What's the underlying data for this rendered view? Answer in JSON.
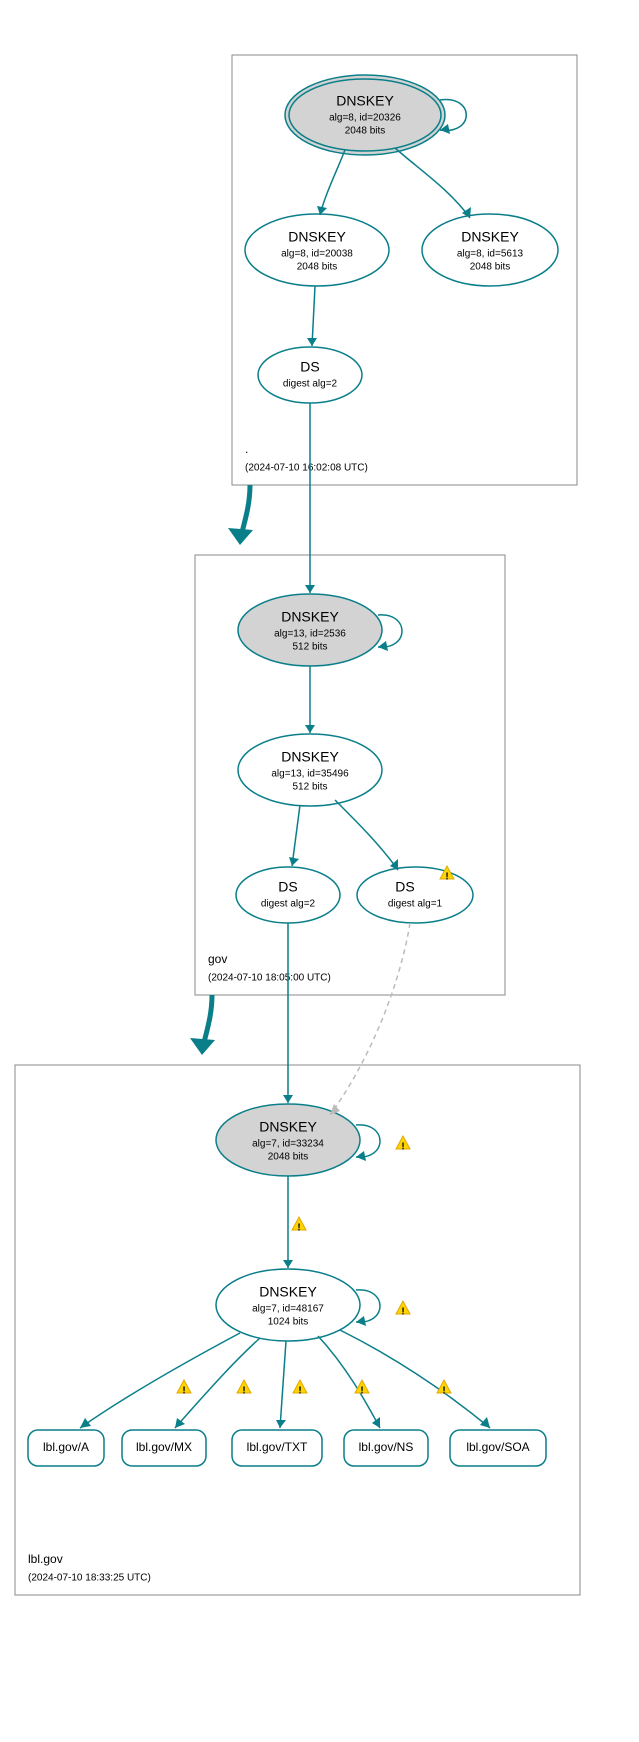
{
  "zones": {
    "root": {
      "name": ".",
      "timestamp": "(2024-07-10 16:02:08 UTC)"
    },
    "gov": {
      "name": "gov",
      "timestamp": "(2024-07-10 18:05:00 UTC)"
    },
    "lbl": {
      "name": "lbl.gov",
      "timestamp": "(2024-07-10 18:33:25 UTC)"
    }
  },
  "nodes": {
    "root_ksk": {
      "title": "DNSKEY",
      "l2": "alg=8, id=20326",
      "l3": "2048 bits"
    },
    "root_zsk1": {
      "title": "DNSKEY",
      "l2": "alg=8, id=20038",
      "l3": "2048 bits"
    },
    "root_zsk2": {
      "title": "DNSKEY",
      "l2": "alg=8, id=5613",
      "l3": "2048 bits"
    },
    "root_ds": {
      "title": "DS",
      "l2": "digest alg=2"
    },
    "gov_ksk": {
      "title": "DNSKEY",
      "l2": "alg=13, id=2536",
      "l3": "512 bits"
    },
    "gov_zsk": {
      "title": "DNSKEY",
      "l2": "alg=13, id=35496",
      "l3": "512 bits"
    },
    "gov_ds1": {
      "title": "DS",
      "l2": "digest alg=2"
    },
    "gov_ds2": {
      "title": "DS",
      "l2": "digest alg=1"
    },
    "lbl_ksk": {
      "title": "DNSKEY",
      "l2": "alg=7, id=33234",
      "l3": "2048 bits"
    },
    "lbl_zsk": {
      "title": "DNSKEY",
      "l2": "alg=7, id=48167",
      "l3": "1024 bits"
    },
    "rr_a": {
      "label": "lbl.gov/A"
    },
    "rr_mx": {
      "label": "lbl.gov/MX"
    },
    "rr_txt": {
      "label": "lbl.gov/TXT"
    },
    "rr_ns": {
      "label": "lbl.gov/NS"
    },
    "rr_soa": {
      "label": "lbl.gov/SOA"
    }
  }
}
